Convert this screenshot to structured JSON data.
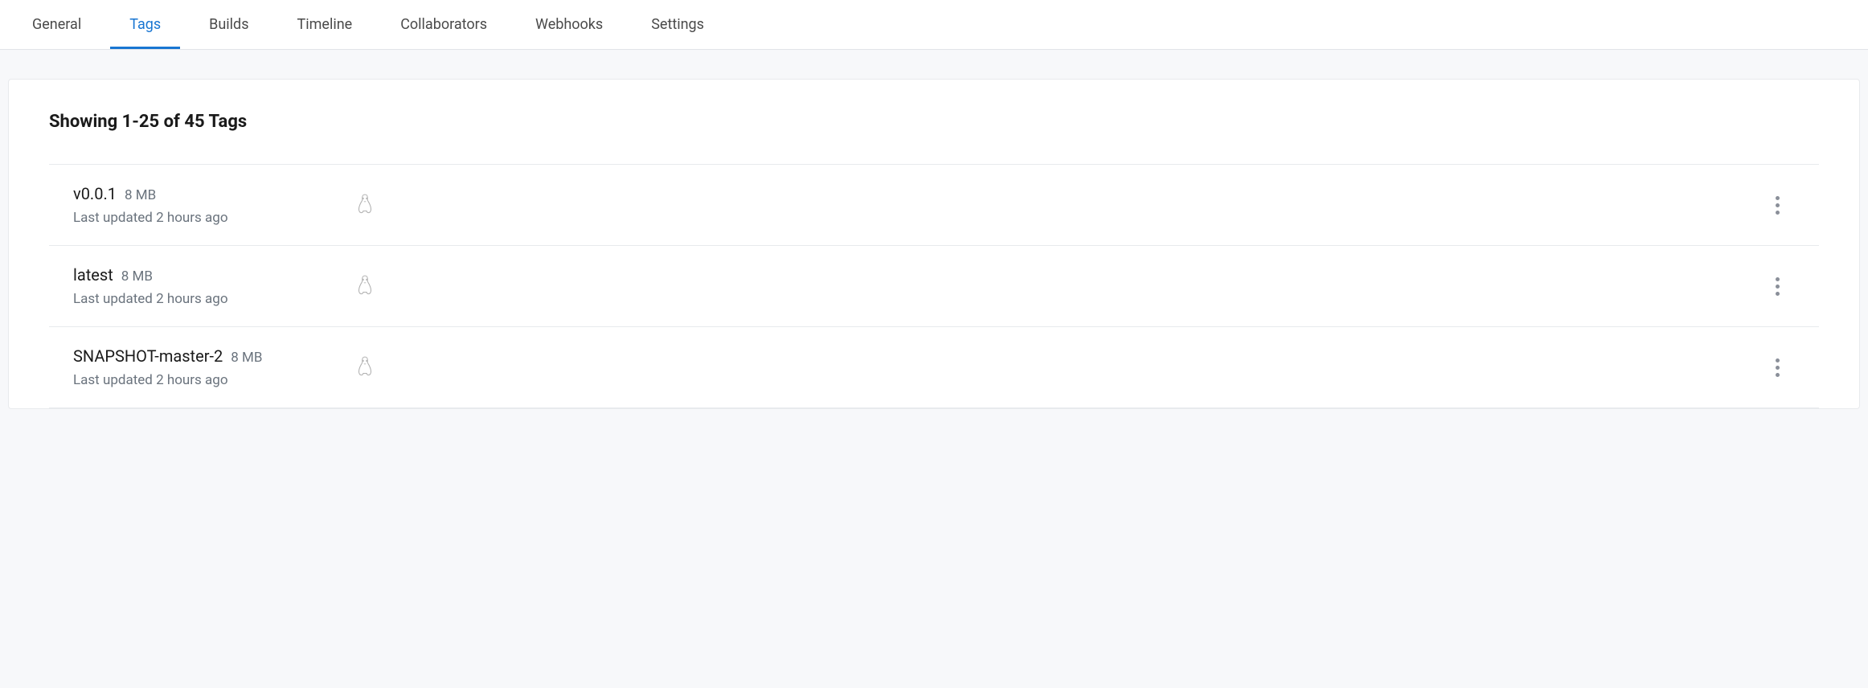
{
  "tabs": [
    {
      "label": "General"
    },
    {
      "label": "Tags"
    },
    {
      "label": "Builds"
    },
    {
      "label": "Timeline"
    },
    {
      "label": "Collaborators"
    },
    {
      "label": "Webhooks"
    },
    {
      "label": "Settings"
    }
  ],
  "active_tab_index": 1,
  "heading": "Showing 1-25 of 45 Tags",
  "tags": [
    {
      "name": "v0.0.1",
      "size": "8 MB",
      "updated": "Last updated 2 hours ago",
      "os": "linux"
    },
    {
      "name": "latest",
      "size": "8 MB",
      "updated": "Last updated 2 hours ago",
      "os": "linux"
    },
    {
      "name": "SNAPSHOT-master-2",
      "size": "8 MB",
      "updated": "Last updated 2 hours ago",
      "os": "linux"
    }
  ]
}
